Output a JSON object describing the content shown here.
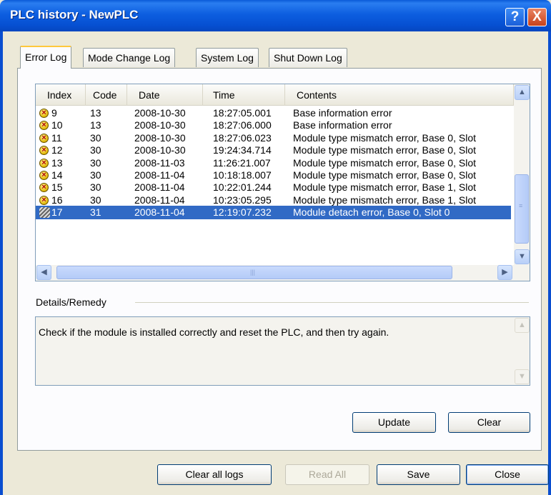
{
  "window": {
    "title": "PLC history - NewPLC",
    "help_glyph": "?",
    "close_glyph": "X"
  },
  "tabs": [
    {
      "label": "Error Log",
      "active": true
    },
    {
      "label": "Mode Change Log",
      "active": false
    },
    {
      "label": "System Log",
      "active": false
    },
    {
      "label": "Shut Down Log",
      "active": false
    }
  ],
  "error_log": {
    "columns": [
      "Index",
      "Code",
      "Date",
      "Time",
      "Contents"
    ],
    "rows": [
      {
        "icon": "error-icon",
        "index": "9",
        "code": "13",
        "date": "2008-10-30",
        "time": "18:27:05.001",
        "contents": "Base information error"
      },
      {
        "icon": "error-icon",
        "index": "10",
        "code": "13",
        "date": "2008-10-30",
        "time": "18:27:06.000",
        "contents": "Base information error"
      },
      {
        "icon": "error-icon",
        "index": "11",
        "code": "30",
        "date": "2008-10-30",
        "time": "18:27:06.023",
        "contents": "Module type mismatch error, Base 0, Slot"
      },
      {
        "icon": "error-icon",
        "index": "12",
        "code": "30",
        "date": "2008-10-30",
        "time": "19:24:34.714",
        "contents": "Module type mismatch error, Base 0, Slot"
      },
      {
        "icon": "error-icon",
        "index": "13",
        "code": "30",
        "date": "2008-11-03",
        "time": "11:26:21.007",
        "contents": "Module type mismatch error, Base 0, Slot"
      },
      {
        "icon": "error-icon",
        "index": "14",
        "code": "30",
        "date": "2008-11-04",
        "time": "10:18:18.007",
        "contents": "Module type mismatch error, Base 0, Slot"
      },
      {
        "icon": "error-icon",
        "index": "15",
        "code": "30",
        "date": "2008-11-04",
        "time": "10:22:01.244",
        "contents": "Module type mismatch error, Base 1, Slot"
      },
      {
        "icon": "error-icon",
        "index": "16",
        "code": "30",
        "date": "2008-11-04",
        "time": "10:23:05.295",
        "contents": "Module type mismatch error, Base 1, Slot"
      },
      {
        "icon": "detach-icon",
        "index": "17",
        "code": "31",
        "date": "2008-11-04",
        "time": "12:19:07.232",
        "contents": "Module detach error, Base 0, Slot 0",
        "selected": true
      }
    ]
  },
  "details": {
    "label": "Details/Remedy",
    "text": "Check if the module is installed correctly and reset the PLC, and then try again."
  },
  "panel_buttons": {
    "update": "Update",
    "clear": "Clear"
  },
  "footer_buttons": {
    "clear_all_logs": "Clear all logs",
    "read_all": "Read All",
    "save": "Save",
    "close": "Close"
  },
  "colors": {
    "titlebar": "#0a5ad8",
    "selection": "#316ac5",
    "active_tab_accent": "#ffc83c"
  }
}
